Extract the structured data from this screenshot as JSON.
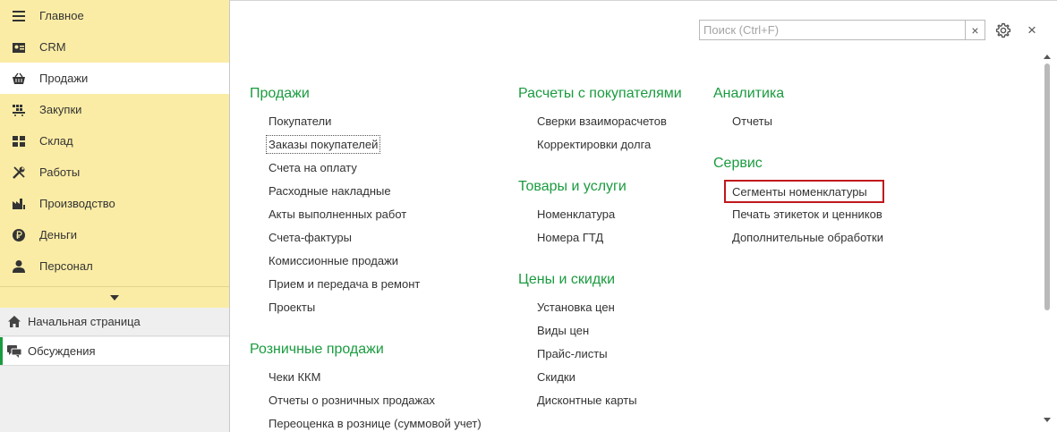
{
  "sidebar": {
    "nav": [
      {
        "label": "Главное",
        "icon": "menu-icon"
      },
      {
        "label": "CRM",
        "icon": "contacts-card-icon"
      },
      {
        "label": "Продажи",
        "icon": "shopping-basket-icon"
      },
      {
        "label": "Закупки",
        "icon": "cart-icon"
      },
      {
        "label": "Склад",
        "icon": "warehouse-grid-icon"
      },
      {
        "label": "Работы",
        "icon": "tools-icon"
      },
      {
        "label": "Производство",
        "icon": "factory-icon"
      },
      {
        "label": "Деньги",
        "icon": "coin-icon"
      },
      {
        "label": "Персонал",
        "icon": "person-icon"
      }
    ],
    "active_nav": "Продажи",
    "more_icon": "chevron-down-icon",
    "bottom": [
      {
        "label": "Начальная страница",
        "icon": "home-icon"
      },
      {
        "label": "Обсуждения",
        "icon": "chat-icon"
      }
    ]
  },
  "toolbar": {
    "search_placeholder": "Поиск (Ctrl+F)",
    "search_value": "",
    "clear_symbol": "×",
    "close_symbol": "×"
  },
  "groups": [
    {
      "title": "Продажи",
      "items": [
        "Покупатели",
        "Заказы покупателей",
        "Счета на оплату",
        "Расходные накладные",
        "Акты выполненных работ",
        "Счета-фактуры",
        "Комиссионные продажи",
        "Прием и передача в ремонт",
        "Проекты"
      ]
    },
    {
      "title": "Розничные продажи",
      "items": [
        "Чеки ККМ",
        "Отчеты о розничных продажах",
        "Переоценка в рознице (суммовой учет)"
      ]
    },
    {
      "title": "Расчеты с покупателями",
      "items": [
        "Сверки взаиморасчетов",
        "Корректировки долга"
      ]
    },
    {
      "title": "Товары и услуги",
      "items": [
        "Номенклатура",
        "Номера ГТД"
      ]
    },
    {
      "title": "Цены и скидки",
      "items": [
        "Установка цен",
        "Виды цен",
        "Прайс-листы",
        "Скидки",
        "Дисконтные карты"
      ]
    },
    {
      "title": "Аналитика",
      "items": [
        "Отчеты"
      ]
    },
    {
      "title": "Сервис",
      "items": [
        "Сегменты номенклатуры",
        "Печать этикеток и ценников",
        "Дополнительные обработки"
      ]
    }
  ],
  "focused_item": "Заказы покупателей",
  "highlighted_item": "Сегменты номенклатуры",
  "colors": {
    "accent_green": "#1a9b3f",
    "sidebar_yellow": "#fbeca5",
    "highlight_red": "#c0171d"
  }
}
